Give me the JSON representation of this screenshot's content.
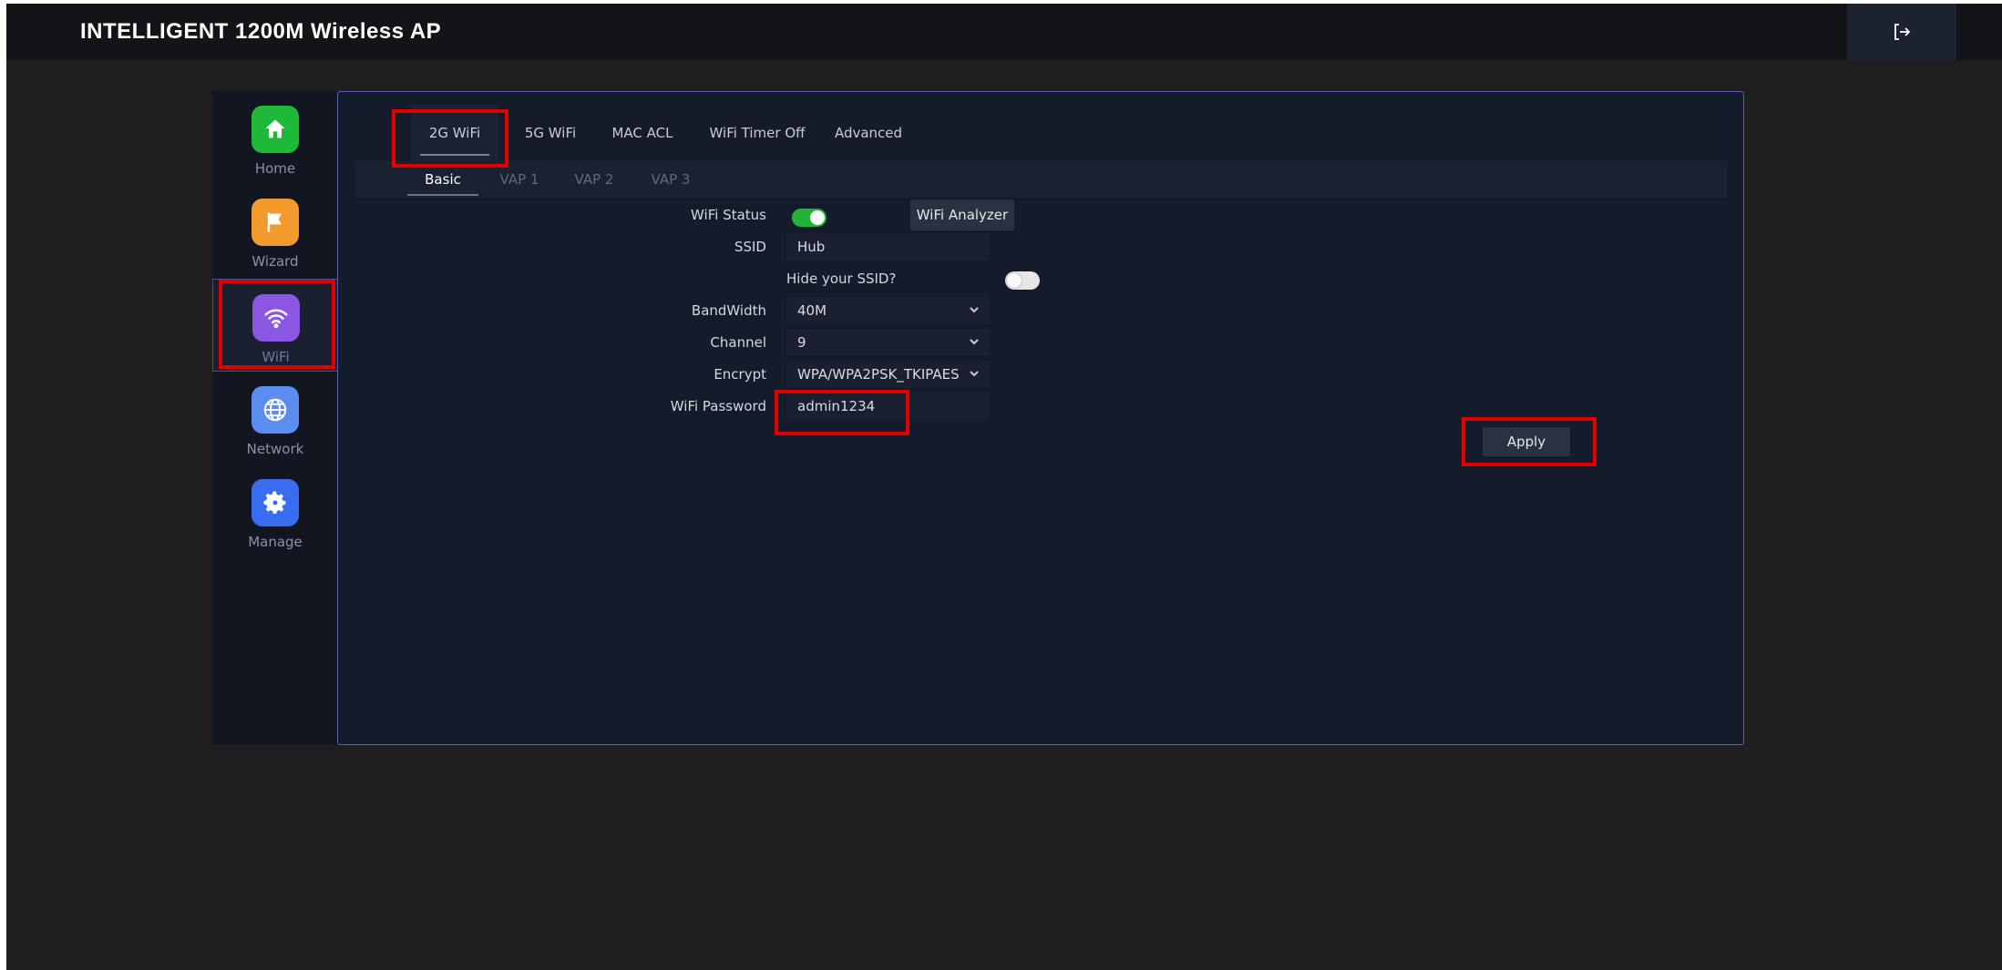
{
  "header": {
    "title": "INTELLIGENT 1200M Wireless AP",
    "logout_icon": "logout-icon"
  },
  "sidebar": {
    "items": [
      {
        "label": "Home",
        "icon": "home-icon",
        "color": "#1fb93a"
      },
      {
        "label": "Wizard",
        "icon": "flag-icon",
        "color": "#f29a2e"
      },
      {
        "label": "WiFi",
        "icon": "wifi-icon",
        "color": "#8a56e2"
      },
      {
        "label": "Network",
        "icon": "globe-icon",
        "color": "#5b8cf0"
      },
      {
        "label": "Manage",
        "icon": "gear-icon",
        "color": "#3a6cf0"
      }
    ],
    "active": "WiFi"
  },
  "tabs": [
    "2G WiFi",
    "5G WiFi",
    "MAC ACL",
    "WiFi Timer Off",
    "Advanced"
  ],
  "subtabs": [
    "Basic",
    "VAP 1",
    "VAP 2",
    "VAP 3"
  ],
  "form": {
    "wifi_status_label": "WiFi Status",
    "wifi_status_on": true,
    "analyzer_button": "WiFi Analyzer",
    "ssid_label": "SSID",
    "ssid_value": "Hub",
    "hide_ssid_label": "Hide your SSID?",
    "hide_ssid_on": false,
    "bandwidth_label": "BandWidth",
    "bandwidth_value": "40M",
    "channel_label": "Channel",
    "channel_value": "9",
    "encrypt_label": "Encrypt",
    "encrypt_value": "WPA/WPA2PSK_TKIPAES",
    "password_label": "WiFi Password",
    "password_value": "admin1234",
    "apply_button": "Apply"
  },
  "colors": {
    "highlight": "#e00000",
    "toggle_on": "#22b43a",
    "accent_border": "#5a5fb0"
  }
}
